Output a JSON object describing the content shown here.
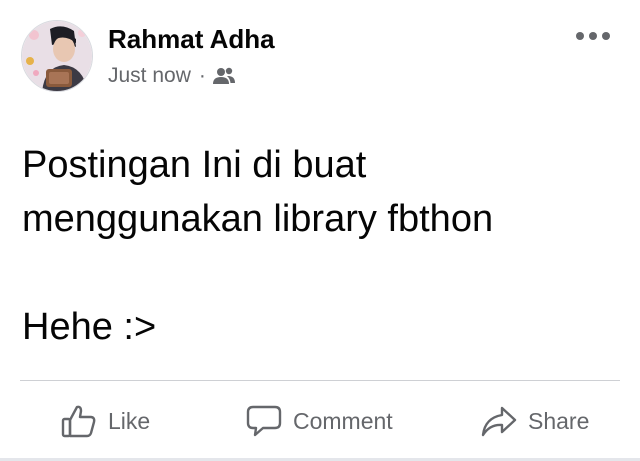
{
  "post": {
    "author": "Rahmat Adha",
    "timestamp": "Just now",
    "separator": "·",
    "audience_icon": "friends-icon",
    "more_icon": "more-horizontal-icon",
    "avatar_icon": "profile-photo",
    "text": "Postingan Ini di buat\nmenggunakan library fbthon\n\nHehe :>"
  },
  "actions": {
    "like_label": "Like",
    "comment_label": "Comment",
    "share_label": "Share"
  },
  "colors": {
    "primary_text": "#050505",
    "secondary_text": "#65676b",
    "divider": "#ced0d4"
  }
}
